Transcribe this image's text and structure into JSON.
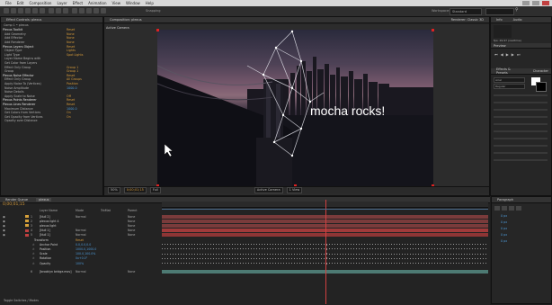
{
  "menu": {
    "items": [
      "File",
      "Edit",
      "Composition",
      "Layer",
      "Effect",
      "Animation",
      "View",
      "Window",
      "Help"
    ]
  },
  "toolbar": {
    "snapping_label": "Snapping",
    "workspace_label": "Workspace:",
    "workspace_value": "Standard"
  },
  "effect_controls": {
    "tab_label": "Effect Controls: plexus",
    "breadcrumb": "Comp 1 • plexus",
    "rows": [
      {
        "label": "Plexus Toolkit",
        "value": "Reset",
        "fx": true
      },
      {
        "label": "Add Geometry",
        "value": "None"
      },
      {
        "label": "Add Effector",
        "value": "None"
      },
      {
        "label": "Add Renderer",
        "value": "None"
      },
      {
        "label": "Plexus Layers Object",
        "value": "Reset",
        "fx": true
      },
      {
        "label": "Object Type",
        "value": "Lights"
      },
      {
        "label": "Light Type",
        "value": "Spot Lights"
      },
      {
        "label": "Layer Name Begins with",
        "value": ""
      },
      {
        "label": "Get Color from Layers",
        "value": ""
      },
      {
        "label": "Effect Only Group",
        "value": "Group 1"
      },
      {
        "label": "Group",
        "value": "Group 1"
      },
      {
        "label": "Plexus Noise Effector",
        "value": "Reset",
        "fx": true
      },
      {
        "label": "Effect Only Group",
        "value": "All Groups"
      },
      {
        "label": "Apply Noise To (Vertices)",
        "value": "Position"
      },
      {
        "label": "Noise Amplitude",
        "value": "1000.0",
        "blue": true
      },
      {
        "label": "Noise Details",
        "value": ""
      },
      {
        "label": "Apply Scale to Noise",
        "value": "Off"
      },
      {
        "label": "Plexus Points Renderer",
        "value": "Reset",
        "fx": true
      },
      {
        "label": "Plexus Lines Renderer",
        "value": "Reset",
        "fx": true
      },
      {
        "label": "Maximum Distance",
        "value": "1000.0",
        "blue": true
      },
      {
        "label": "Get Colors from Vertices",
        "value": "On"
      },
      {
        "label": "Get Opacity from Vertices",
        "value": "On"
      },
      {
        "label": "Opacity over Distance",
        "value": ""
      }
    ]
  },
  "viewer": {
    "tab_label": "Composition: plexus",
    "header_right": "Renderer: Classic 3D",
    "camera_label": "Active Camera",
    "caption": "mocha rocks!",
    "zoom": "50%",
    "timecode": "0;00;01;15",
    "resolution": "Full",
    "view_camera": "Active Camera",
    "views": "1 View"
  },
  "right_panel": {
    "info_tab": "Info",
    "audio_tab": "Audio",
    "info_fps": "fps: 29.97 (realtime)",
    "preview_tab": "Preview",
    "effects_tab": "Effects & Presets",
    "character_tab": "Character",
    "font_value": "Arial",
    "style_value": "Regular",
    "paragraph_tab": "Paragraph",
    "paragraph_values": [
      "0 px",
      "0 px",
      "0 px",
      "0 px",
      "0 px"
    ]
  },
  "timeline": {
    "tab_render": "Render Queue",
    "tab_comp": "plexus",
    "timecode": "0;00;01;15",
    "columns": {
      "name": "Layer Name",
      "mode": "Mode",
      "trkmat": "TrkMat",
      "parent": "Parent"
    },
    "layers": [
      {
        "idx": "1",
        "name": "[Null 2]",
        "mode": "Normal",
        "parent": "None",
        "color": "#d8a13a"
      },
      {
        "idx": "2",
        "name": "plexus light 4",
        "mode": "",
        "parent": "None",
        "color": "#d8a13a"
      },
      {
        "idx": "3",
        "name": "plexus light",
        "mode": "",
        "parent": "None",
        "color": "#d8a13a"
      },
      {
        "idx": "4",
        "name": "[Null 1]",
        "mode": "Normal",
        "parent": "None",
        "color": "#c04040"
      },
      {
        "idx": "5",
        "name": "[Null 1]",
        "mode": "Normal",
        "parent": "None",
        "color": "#c04040"
      }
    ],
    "transform_label": "Transform",
    "reset_label": "Reset",
    "properties": [
      {
        "name": "Anchor Point",
        "value": "0.0,0.0,0.0"
      },
      {
        "name": "Position",
        "value": "1000.0,1000.0"
      },
      {
        "name": "Scale",
        "value": "100.0,100.0%"
      },
      {
        "name": "Rotation",
        "value": "0x+0.0°"
      },
      {
        "name": "Opacity",
        "value": "100%"
      }
    ],
    "footer_layer": {
      "idx": "6",
      "name": "[brooklyn bridge.mov]",
      "mode": "Normal",
      "parent": "None"
    },
    "toggle_label": "Toggle Switches / Modes"
  },
  "colors": {
    "accent_orange": "#d59a3a",
    "value_blue": "#4e9ad8",
    "playhead": "#d04040",
    "layer_red": "#8e3535",
    "layer_teal": "#4d7a73"
  }
}
